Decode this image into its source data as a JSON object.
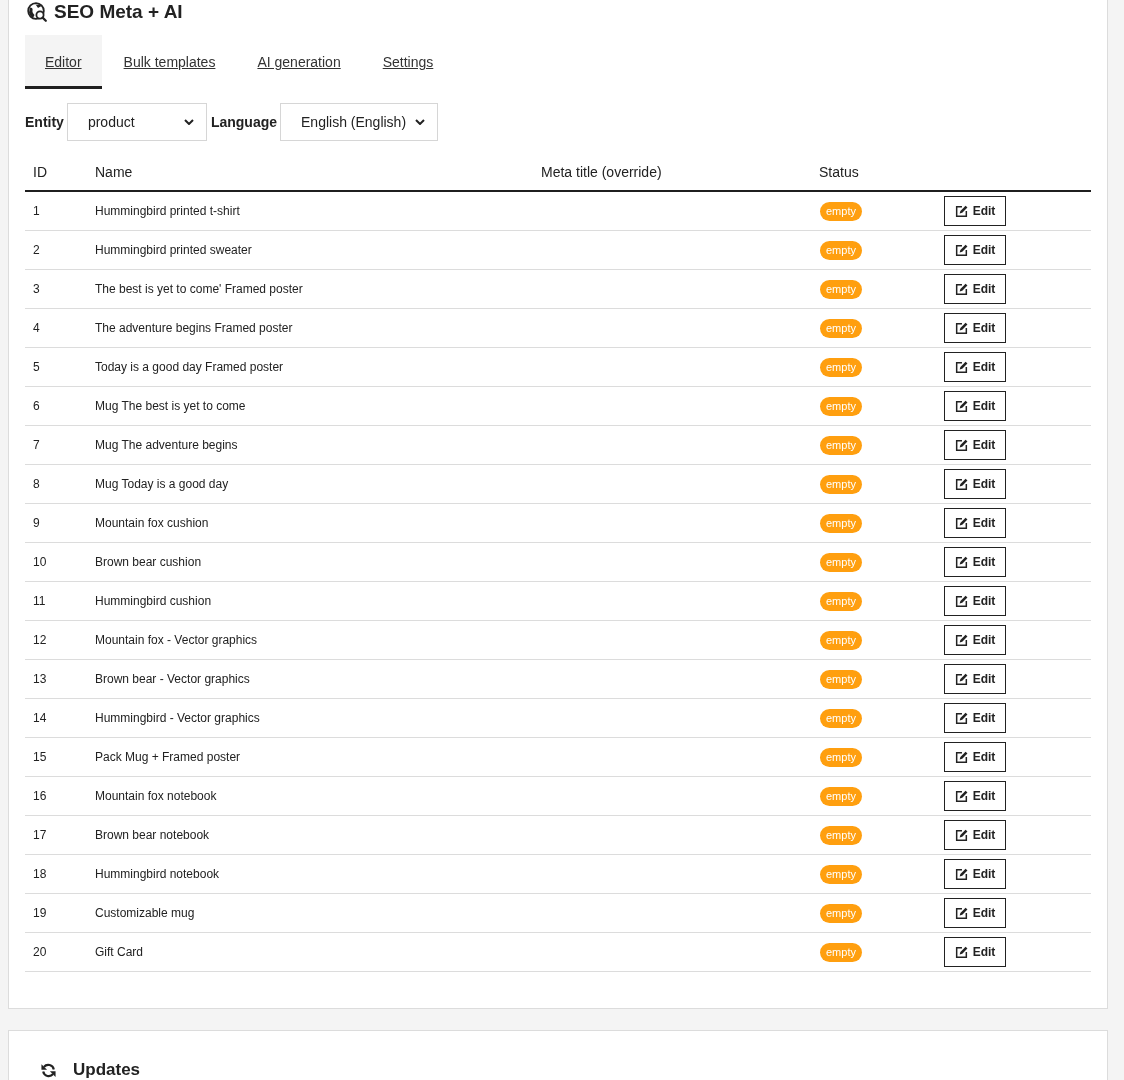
{
  "header": {
    "title": "SEO Meta + AI"
  },
  "tabs": [
    {
      "label": "Editor",
      "selected": true
    },
    {
      "label": "Bulk templates",
      "selected": false
    },
    {
      "label": "AI generation",
      "selected": false
    },
    {
      "label": "Settings",
      "selected": false
    }
  ],
  "filters": [
    {
      "label": "Entity",
      "value": "product"
    },
    {
      "label": "Language",
      "value": "English (English)"
    }
  ],
  "table": {
    "columns": [
      "ID",
      "Name",
      "Meta title (override)",
      "Status"
    ],
    "rows": [
      {
        "id": "1",
        "name": "Hummingbird printed t-shirt",
        "status": "empty",
        "action": "Edit"
      },
      {
        "id": "2",
        "name": "Hummingbird printed sweater",
        "status": "empty",
        "action": "Edit"
      },
      {
        "id": "3",
        "name": "The best is yet to come' Framed poster",
        "status": "empty",
        "action": "Edit"
      },
      {
        "id": "4",
        "name": "The adventure begins Framed poster",
        "status": "empty",
        "action": "Edit"
      },
      {
        "id": "5",
        "name": "Today is a good day Framed poster",
        "status": "empty",
        "action": "Edit"
      },
      {
        "id": "6",
        "name": "Mug The best is yet to come",
        "status": "empty",
        "action": "Edit"
      },
      {
        "id": "7",
        "name": "Mug The adventure begins",
        "status": "empty",
        "action": "Edit"
      },
      {
        "id": "8",
        "name": "Mug Today is a good day",
        "status": "empty",
        "action": "Edit"
      },
      {
        "id": "9",
        "name": "Mountain fox cushion",
        "status": "empty",
        "action": "Edit"
      },
      {
        "id": "10",
        "name": "Brown bear cushion",
        "status": "empty",
        "action": "Edit"
      },
      {
        "id": "11",
        "name": "Hummingbird cushion",
        "status": "empty",
        "action": "Edit"
      },
      {
        "id": "12",
        "name": "Mountain fox - Vector graphics",
        "status": "empty",
        "action": "Edit"
      },
      {
        "id": "13",
        "name": "Brown bear - Vector graphics",
        "status": "empty",
        "action": "Edit"
      },
      {
        "id": "14",
        "name": "Hummingbird - Vector graphics",
        "status": "empty",
        "action": "Edit"
      },
      {
        "id": "15",
        "name": "Pack Mug + Framed poster",
        "status": "empty",
        "action": "Edit"
      },
      {
        "id": "16",
        "name": "Mountain fox notebook",
        "status": "empty",
        "action": "Edit"
      },
      {
        "id": "17",
        "name": "Brown bear notebook",
        "status": "empty",
        "action": "Edit"
      },
      {
        "id": "18",
        "name": "Hummingbird notebook",
        "status": "empty",
        "action": "Edit"
      },
      {
        "id": "19",
        "name": "Customizable mug",
        "status": "empty",
        "action": "Edit"
      },
      {
        "id": "20",
        "name": "Gift Card",
        "status": "empty",
        "action": "Edit"
      }
    ]
  },
  "updates_panel": {
    "title": "Updates"
  }
}
